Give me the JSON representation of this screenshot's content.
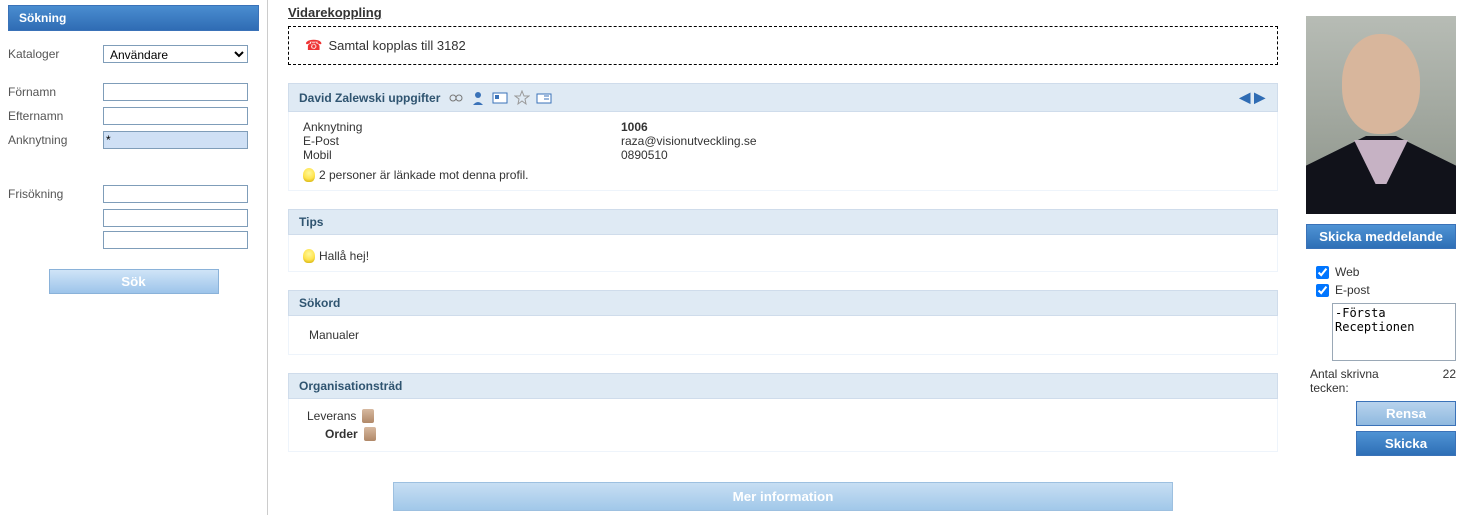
{
  "sidebar": {
    "header": "Sökning",
    "catalogsLabel": "Kataloger",
    "catalogSelected": "Användare",
    "firstNameLabel": "Förnamn",
    "lastNameLabel": "Efternamn",
    "extensionLabel": "Anknytning",
    "extensionValue": "*",
    "freeSearchLabel": "Frisökning",
    "searchBtn": "Sök"
  },
  "forwarding": {
    "title": "Vidarekoppling",
    "text": "Samtal kopplas till 3182"
  },
  "userHeader": "David Zalewski uppgifter",
  "details": {
    "extLabel": "Anknytning",
    "extValue": "1006",
    "emailLabel": "E-Post",
    "emailValue": "raza@visionutveckling.se",
    "mobileLabel": "Mobil",
    "mobileValue": "0890510",
    "linkedText": "2 personer är länkade mot denna profil."
  },
  "tips": {
    "header": "Tips",
    "text": "Hallå hej!"
  },
  "keywords": {
    "header": "Sökord",
    "item": "Manualer"
  },
  "orgtree": {
    "header": "Organisationsträd",
    "item1": "Leverans",
    "item2": "Order"
  },
  "moreInfo": "Mer information",
  "rightbar": {
    "sendMsgBtn": "Skicka meddelande",
    "webLabel": "Web",
    "emailLabel": "E-post",
    "msgContent": "-Första Receptionen",
    "charCountLabel": "Antal skrivna tecken:",
    "charCount": "22",
    "clearBtn": "Rensa",
    "sendBtn": "Skicka"
  }
}
